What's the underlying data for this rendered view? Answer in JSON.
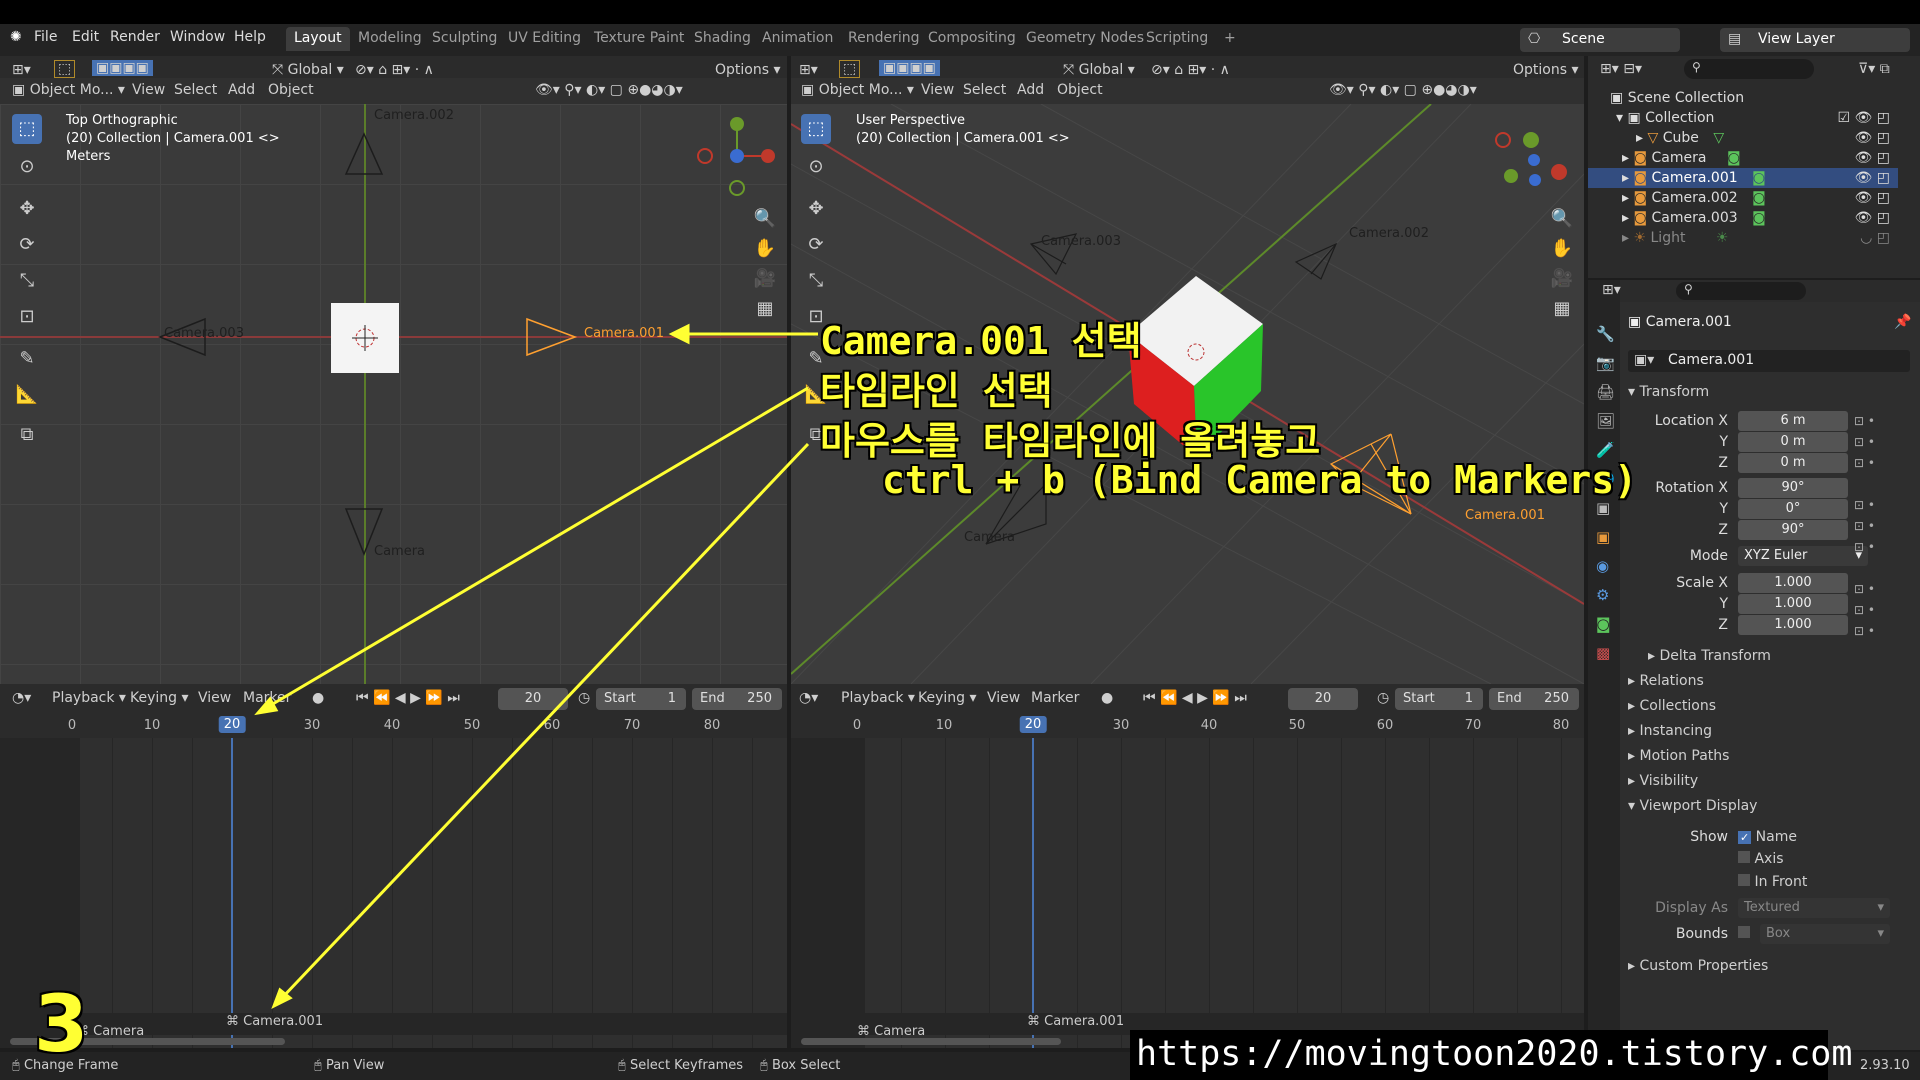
{
  "menu": {
    "app_icon": "blender-icon",
    "file": "File",
    "edit": "Edit",
    "render": "Render",
    "window": "Window",
    "help": "Help"
  },
  "workspaces": [
    "Layout",
    "Modeling",
    "Sculpting",
    "UV Editing",
    "Texture Paint",
    "Shading",
    "Animation",
    "Rendering",
    "Compositing",
    "Geometry Nodes",
    "Scripting",
    "+"
  ],
  "scene": {
    "name": "Scene",
    "view_layer": "View Layer"
  },
  "viewport_left": {
    "mode": "Object Mo...",
    "view": "View",
    "select": "Select",
    "add": "Add",
    "object": "Object",
    "transform": "Global",
    "options": "Options",
    "info_line1": "Top Orthographic",
    "info_line2": "(20) Collection | Camera.001 <>",
    "info_line3": "Meters",
    "cam_top": "Camera.002",
    "cam_left": "Camera.003",
    "cam_right": "Camera.001",
    "cam_bottom": "Camera"
  },
  "viewport_right": {
    "mode": "Object Mo...",
    "view": "View",
    "select": "Select",
    "add": "Add",
    "object": "Object",
    "transform": "Global",
    "options": "Options",
    "info_line1": "User Perspective",
    "info_line2": "(20) Collection | Camera.001 <>",
    "cam_a": "Camera.003",
    "cam_b": "Camera.002",
    "cam_c": "Camera",
    "cam_d": "Camera.001"
  },
  "timeline_left": {
    "playback": "Playback",
    "keying": "Keying",
    "view": "View",
    "marker": "Marker",
    "frame": "20",
    "start_label": "Start",
    "start": "1",
    "end_label": "End",
    "end": "250",
    "ticks": [
      "0",
      "10",
      "20",
      "30",
      "40",
      "50",
      "60",
      "70",
      "80"
    ],
    "markers": [
      "Camera",
      "Camera.001"
    ]
  },
  "timeline_right": {
    "playback": "Playback",
    "keying": "Keying",
    "view": "View",
    "marker": "Marker",
    "frame": "20",
    "start_label": "Start",
    "start": "1",
    "end_label": "End",
    "end": "250",
    "ticks": [
      "0",
      "10",
      "20",
      "30",
      "40",
      "50",
      "60",
      "70",
      "80"
    ],
    "markers": [
      "Camera",
      "Camera.001"
    ]
  },
  "outliner": {
    "root": "Scene Collection",
    "collection": "Collection",
    "items": [
      "Cube",
      "Camera",
      "Camera.001",
      "Camera.002",
      "Camera.003",
      "Light"
    ]
  },
  "properties": {
    "object_name": "Camera.001",
    "data_name": "Camera.001",
    "transform": "Transform",
    "loc_label": "Location X",
    "loc": [
      "6 m",
      "0 m",
      "0 m"
    ],
    "rot_label": "Rotation X",
    "rot": [
      "90°",
      "0°",
      "90°"
    ],
    "mode_label": "Mode",
    "mode": "XYZ Euler",
    "scale_label": "Scale X",
    "scale": [
      "1.000",
      "1.000",
      "1.000"
    ],
    "y": "Y",
    "z": "Z",
    "sections": [
      "Delta Transform",
      "Relations",
      "Collections",
      "Instancing",
      "Motion Paths",
      "Visibility",
      "Viewport Display"
    ],
    "show_label": "Show",
    "name_cb": "Name",
    "axis_cb": "Axis",
    "infront_cb": "In Front",
    "display_as_label": "Display As",
    "display_as": "Textured",
    "bounds_label": "Bounds",
    "bounds": "Box",
    "custom": "Custom Properties"
  },
  "status": {
    "change_frame": "Change Frame",
    "pan_view": "Pan View",
    "select_keyframes": "Select Keyframes",
    "box_select": "Box Select",
    "version": "2.93.10"
  },
  "annotation": {
    "line1": "Camera.001 선택",
    "line2": "타임라인 선택",
    "line3": "마우스를 타임라인에 올려놓고",
    "line4": "ctrl + b (Bind Camera to Markers)",
    "step": "3",
    "url": "https://movingtoon2020.tistory.com"
  },
  "colors": {
    "accent": "#4772b3",
    "camera_selected": "#ffa030",
    "annotation": "#ffff33",
    "x_axis": "#c0392b",
    "y_axis": "#6a9a2a"
  }
}
